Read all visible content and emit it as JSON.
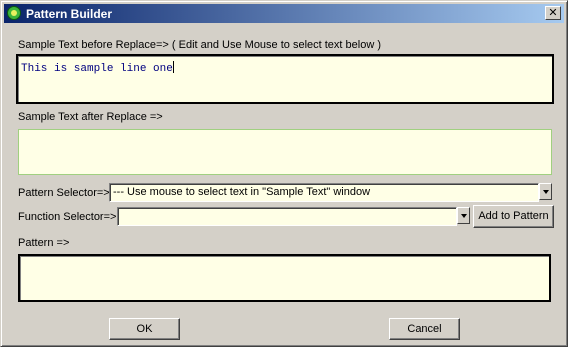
{
  "window": {
    "title": "Pattern Builder",
    "close_glyph": "✕"
  },
  "sample_before": {
    "label": "Sample Text before Replace=> ( Edit and Use Mouse to select text below )",
    "value": "This is sample line one"
  },
  "sample_after": {
    "label": "Sample Text after Replace =>",
    "value": ""
  },
  "pattern_selector": {
    "label": "Pattern Selector=>",
    "value": "--- Use mouse to select text in \"Sample Text\" window"
  },
  "function_selector": {
    "label": "Function Selector=>",
    "value": ""
  },
  "add_button": {
    "label": "Add to Pattern"
  },
  "pattern": {
    "label": "Pattern =>",
    "value": ""
  },
  "ok_button": {
    "label": "OK"
  },
  "cancel_button": {
    "label": "Cancel"
  },
  "colors": {
    "title_start": "#0a246a",
    "title_end": "#a6caf0",
    "field_bg": "#ffffe6",
    "sample_text": "#000080"
  }
}
